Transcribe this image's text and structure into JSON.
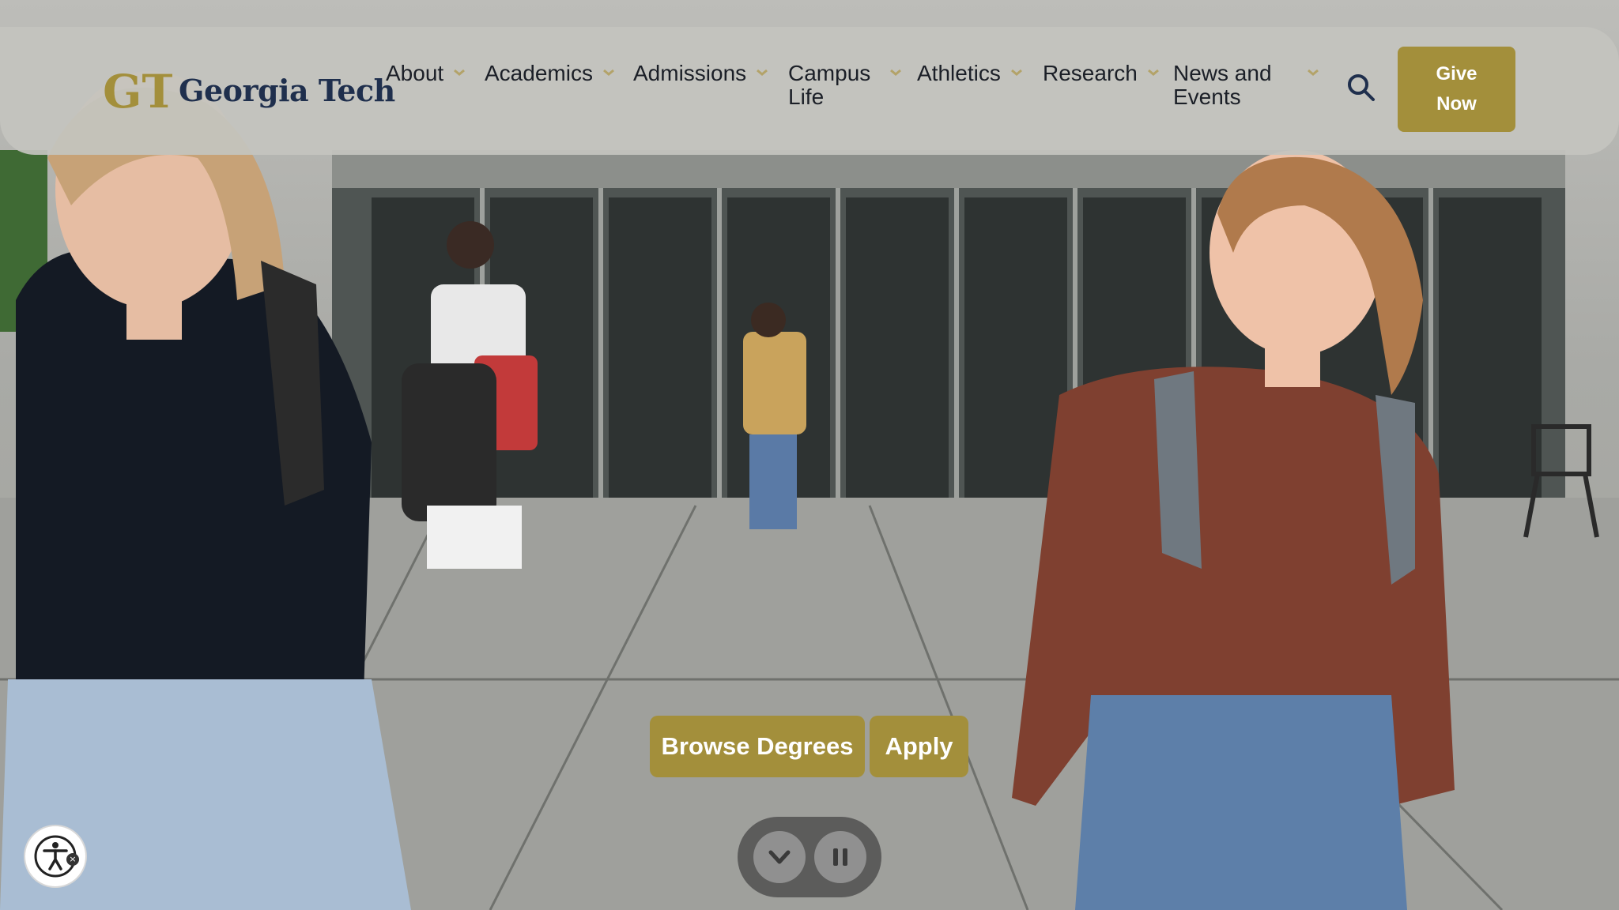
{
  "header": {
    "logo_text": "Georgia Tech",
    "logo_mark": "GT",
    "nav": [
      {
        "label_line1": "About",
        "label_line2": ""
      },
      {
        "label_line1": "Academics",
        "label_line2": ""
      },
      {
        "label_line1": "Admissions",
        "label_line2": ""
      },
      {
        "label_line1": "Campus",
        "label_line2": "Life"
      },
      {
        "label_line1": "Athletics",
        "label_line2": ""
      },
      {
        "label_line1": "Research",
        "label_line2": ""
      },
      {
        "label_line1": "News and",
        "label_line2": "Events"
      }
    ],
    "search_icon": "search-icon",
    "give_now_line1": "Give",
    "give_now_line2": "Now"
  },
  "hero": {
    "cta_primary": "Browse Degrees",
    "cta_secondary": "Apply"
  },
  "video_controls": {
    "scroll_icon": "chevron-down-icon",
    "pause_icon": "pause-icon"
  },
  "accessibility": {
    "icon": "accessibility-icon"
  },
  "colors": {
    "gold": "#A38F3B",
    "navy": "#1F2F4D",
    "chevron": "#B3A369"
  }
}
